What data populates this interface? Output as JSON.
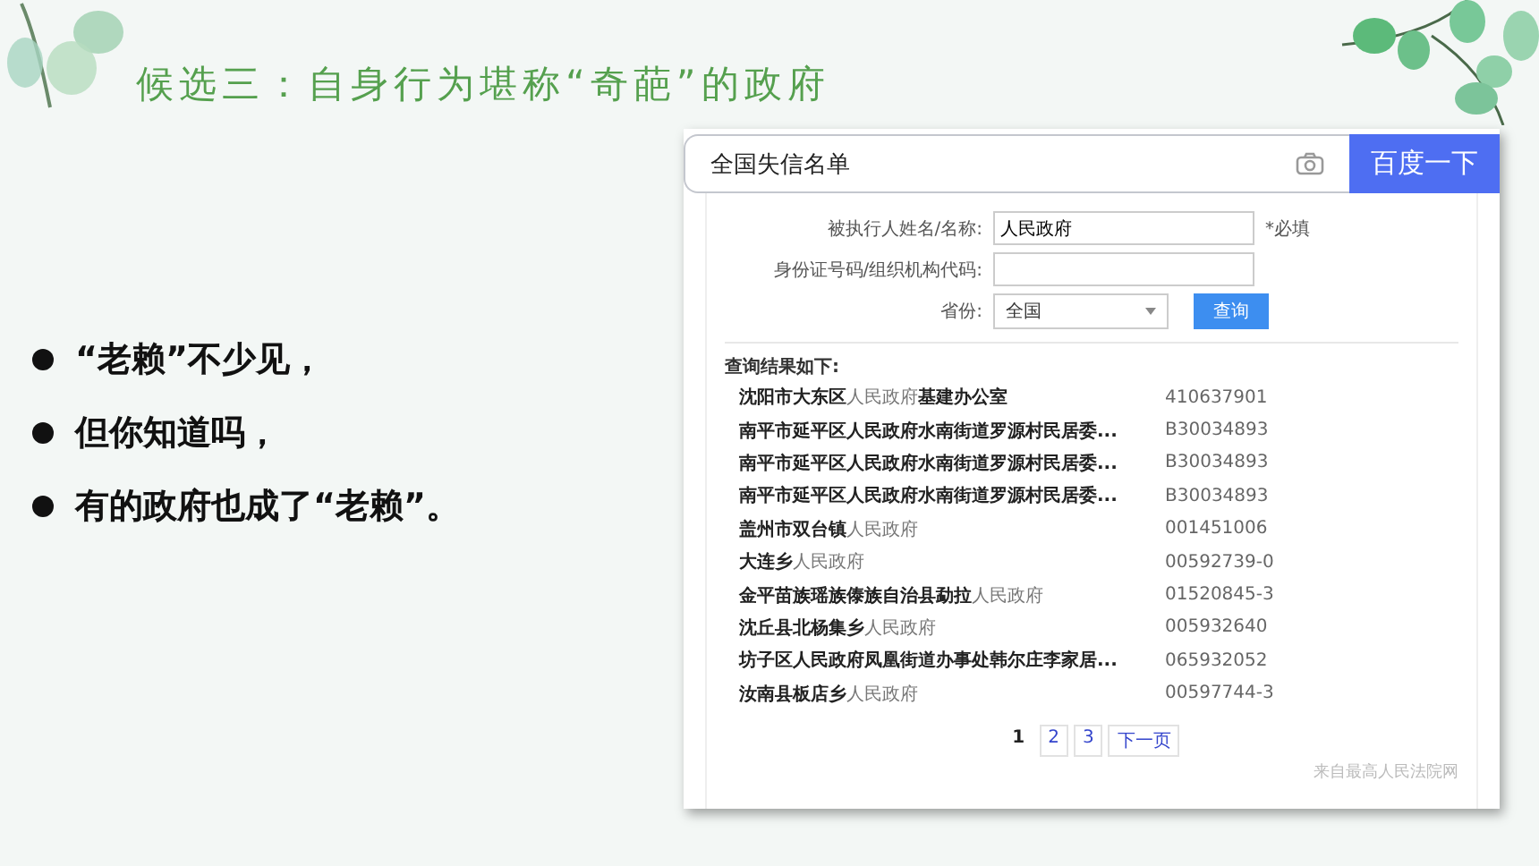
{
  "title": "候选三：自身行为堪称“奇葩”的政府",
  "bullets": [
    "“老赖”不少见，",
    "但你知道吗，",
    "有的政府也成了“老赖”。"
  ],
  "screenshot": {
    "search": {
      "value": "全国失信名单",
      "button": "百度一下"
    },
    "form": [
      {
        "kind": "text",
        "label": "被执行人姓名/名称:",
        "value": "人民政府",
        "note": "*必填"
      },
      {
        "kind": "text",
        "label": "身份证号码/组织机构代码:"
      },
      {
        "kind": "select",
        "label": "省份:",
        "value": "全国",
        "button": "查询"
      }
    ],
    "results_heading": "查询结果如下:",
    "results": [
      {
        "name": "**沈阳市大东区**人民政府**基建办公室**",
        "code": "410637901"
      },
      {
        "name": "**南平市延平区人民政府水南街道罗源村民居委...**",
        "code": "B30034893"
      },
      {
        "name": "**南平市延平区人民政府水南街道罗源村民居委...**",
        "code": "B30034893"
      },
      {
        "name": "**南平市延平区人民政府水南街道罗源村民居委...**",
        "code": "B30034893"
      },
      {
        "name": "**盖州市双台镇**人民政府",
        "code": "001451006"
      },
      {
        "name": "**大连乡**人民政府",
        "code": "00592739-0"
      },
      {
        "name": "**金平苗族瑶族傣族自治县勐拉**人民政府",
        "code": "01520845-3"
      },
      {
        "name": "**沈丘县北杨集乡**人民政府",
        "code": "005932640"
      },
      {
        "name": "**坊子区人民政府凤凰街道办事处韩尔庄李家居...**",
        "code": "065932052"
      },
      {
        "name": "**汝南县板店乡**人民政府",
        "code": "00597744-3"
      }
    ],
    "pages": [
      {
        "label": "1",
        "selected": true
      },
      {
        "label": "2",
        "selected": false
      },
      {
        "label": "3",
        "selected": false
      },
      {
        "label": "下一页",
        "selected": false
      }
    ],
    "source": "来自最高人民法院网"
  }
}
